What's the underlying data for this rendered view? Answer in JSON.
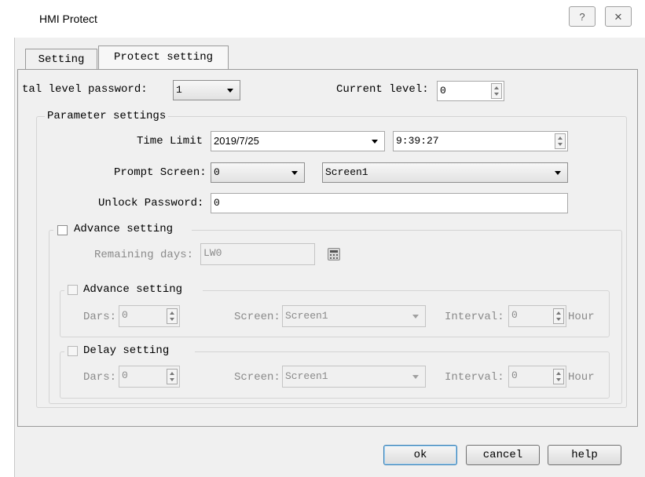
{
  "window": {
    "title": "HMI Protect",
    "help_glyph": "?",
    "close_glyph": "✕"
  },
  "tabs": [
    {
      "label": "Setting"
    },
    {
      "label": "Protect setting"
    }
  ],
  "total_level_password": {
    "label": "tal level password:",
    "value": "1"
  },
  "current_level": {
    "label": "Current level:",
    "value": "0"
  },
  "parameter_settings": {
    "title": "Parameter settings",
    "time_limit": {
      "label": "Time Limit",
      "date": "2019/7/25",
      "time": "9:39:27"
    },
    "prompt_screen": {
      "label": "Prompt Screen:",
      "number": "0",
      "screen": "Screen1"
    },
    "unlock_password": {
      "label": "Unlock Password:",
      "value": "0"
    }
  },
  "advance_setting": {
    "title": "Advance setting",
    "remaining_days": {
      "label": "Remaining days:",
      "value": "LW0"
    },
    "advance": {
      "title": "Advance setting",
      "days_label": "Dars:",
      "days_value": "0",
      "screen_label": "Screen:",
      "screen_value": "Screen1",
      "interval_label": "Interval:",
      "interval_value": "0",
      "unit": "Hour"
    },
    "delay": {
      "title": "Delay setting",
      "days_label": "Dars:",
      "days_value": "0",
      "screen_label": "Screen:",
      "screen_value": "Screen1",
      "interval_label": "Interval:",
      "interval_value": "0",
      "unit": "Hour"
    }
  },
  "buttons": {
    "ok": "ok",
    "cancel": "cancel",
    "help": "help"
  }
}
